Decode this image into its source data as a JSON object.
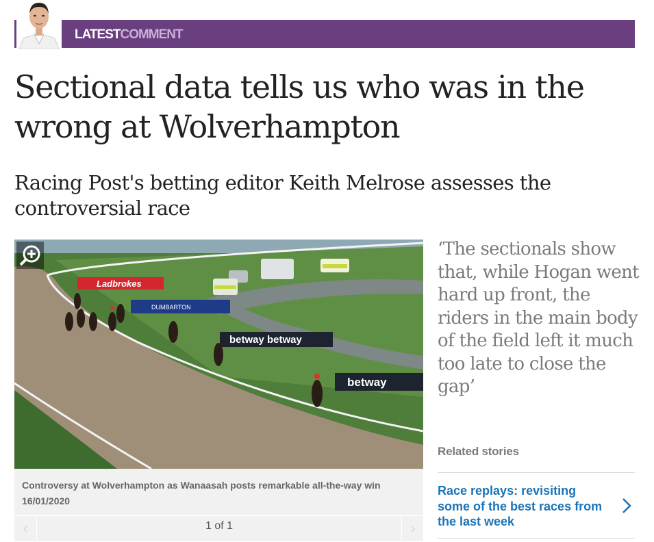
{
  "banner": {
    "label_main": "LATEST",
    "label_accent": "COMMENT",
    "color": "#6a3f7f"
  },
  "article": {
    "headline": "Sectional data tells us who was in the wrong at Wolverhampton",
    "standfirst": "Racing Post's betting editor Keith Melrose assesses the controversial race"
  },
  "gallery": {
    "caption": "Controversy at Wolverhampton as Wanaasah posts remarkable all-the-way win 16/01/2020",
    "counter": "1 of 1",
    "zoom_icon": "zoom-in-icon",
    "prev_icon": "chevron-left-icon",
    "next_icon": "chevron-right-icon",
    "photo_signage": {
      "sign1": "Ladbrokes",
      "sign2": "betway betway",
      "sign3": "betway",
      "sign4": "DUMBARTON"
    }
  },
  "pullquote": {
    "text": "‘The sectionals show that, while Hogan went hard up front, the riders in the main body of the field left it much too late to close the gap’"
  },
  "related": {
    "title": "Related stories",
    "items": [
      {
        "label": "Race replays: revisiting some of the best races from the last week",
        "icon": "chevron-right-icon"
      }
    ],
    "link_color": "#1b74b8"
  }
}
